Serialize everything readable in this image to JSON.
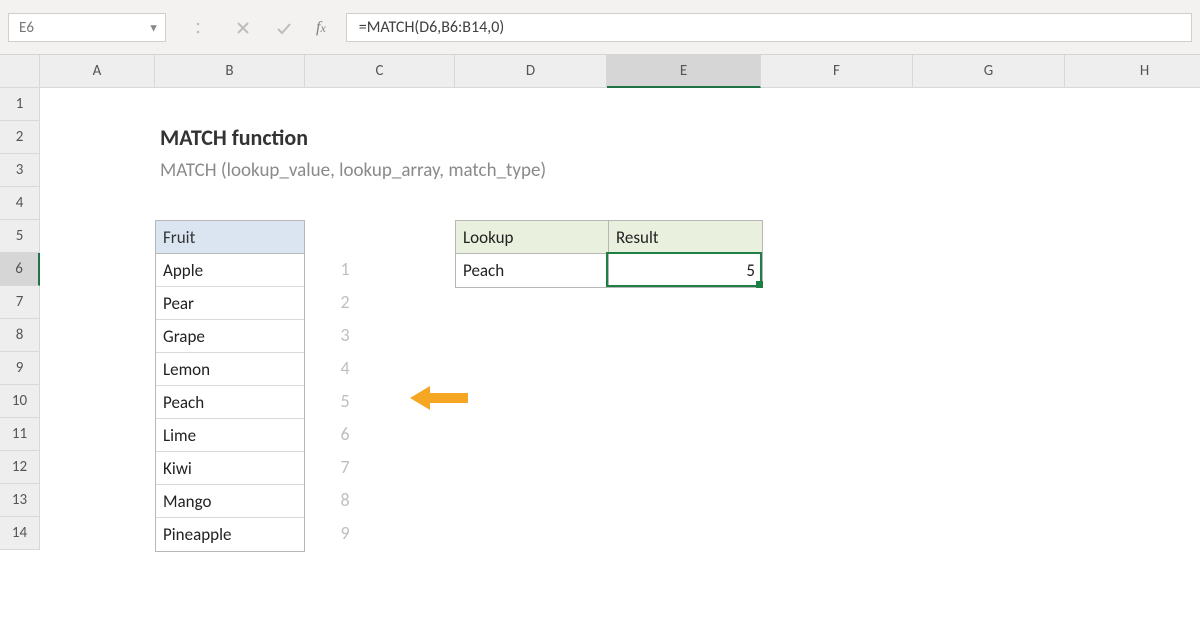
{
  "name_box": {
    "value": "E6"
  },
  "formula_bar": {
    "text": "=MATCH(D6,B6:B14,0)"
  },
  "columns": [
    "A",
    "B",
    "C",
    "D",
    "E",
    "F",
    "G",
    "H"
  ],
  "rows": [
    "1",
    "2",
    "3",
    "4",
    "5",
    "6",
    "7",
    "8",
    "9",
    "10",
    "11",
    "12",
    "13",
    "14"
  ],
  "active": {
    "col": "E",
    "row": "6"
  },
  "content": {
    "title": "MATCH function",
    "syntax": "MATCH (lookup_value, lookup_array, match_type)"
  },
  "fruit_table": {
    "header": "Fruit",
    "items": [
      "Apple",
      "Pear",
      "Grape",
      "Lemon",
      "Peach",
      "Lime",
      "Kiwi",
      "Mango",
      "Pineapple"
    ]
  },
  "index_numbers": [
    "1",
    "2",
    "3",
    "4",
    "5",
    "6",
    "7",
    "8",
    "9"
  ],
  "lookup_box": {
    "headers": {
      "lookup": "Lookup",
      "result": "Result"
    },
    "lookup_value": "Peach",
    "result_value": "5"
  },
  "arrow": {
    "points_to_index": "5"
  }
}
